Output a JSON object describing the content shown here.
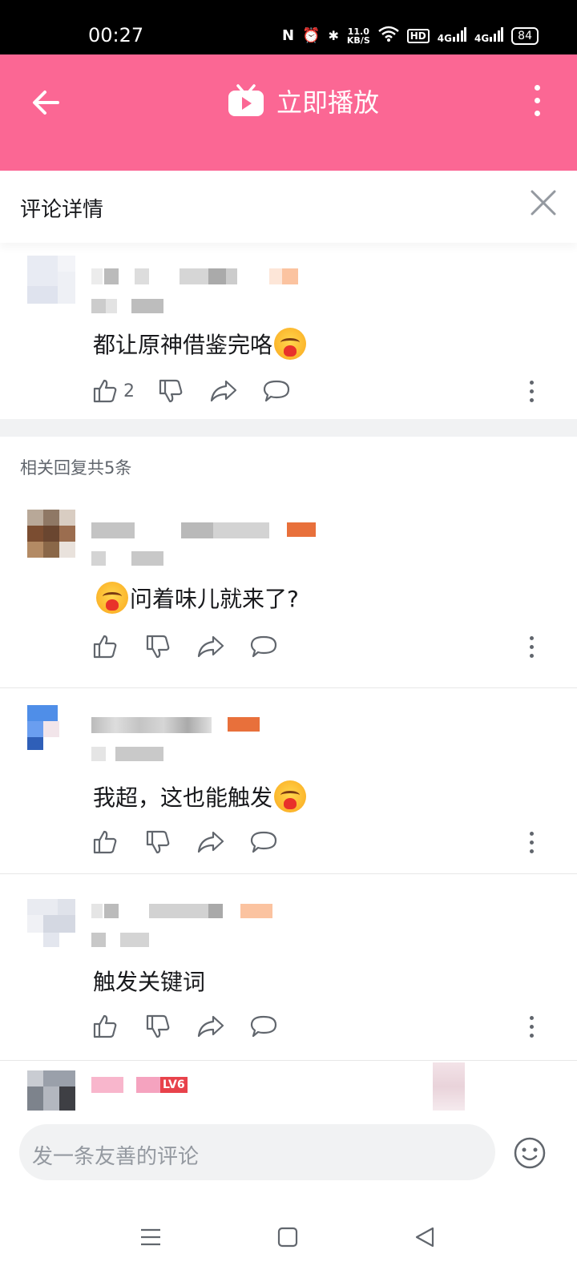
{
  "status_bar": {
    "time": "00:27",
    "speed_value": "11.0",
    "speed_unit": "KB/S",
    "hd_label": "HD",
    "net1": "4G",
    "net2": "4G",
    "battery": "84"
  },
  "header": {
    "title": "立即播放",
    "tv_icon": "tv-icon",
    "back_icon": "arrow-left-icon",
    "more_icon": "more-vertical-icon",
    "accent_color": "#fb6794"
  },
  "detail": {
    "title": "评论详情",
    "close_icon": "close-icon"
  },
  "main_comment": {
    "text": "都让原神借鉴完咯",
    "emoji": "heart-hug-emoji",
    "like_count": "2"
  },
  "replies_label": "相关回复共5条",
  "replies": [
    {
      "text": "问着味儿就来了?",
      "emoji_position": "before"
    },
    {
      "text": "我超，这也能触发",
      "emoji_position": "after"
    },
    {
      "text": "触发关键词",
      "emoji_position": "none"
    }
  ],
  "partial_badge": "LV6",
  "input": {
    "placeholder": "发一条友善的评论",
    "emoji_icon": "smiley-icon"
  },
  "nav": {
    "menu_icon": "menu-icon",
    "home_icon": "square-home-icon",
    "back_icon": "triangle-back-icon"
  }
}
